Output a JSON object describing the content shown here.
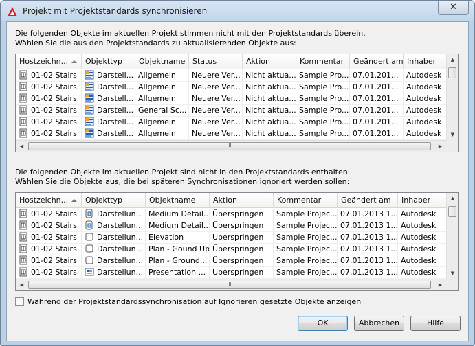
{
  "window": {
    "title": "Projekt mit Projektstandards synchronisieren",
    "close_glyph": "✕"
  },
  "section1": {
    "line1": "Die folgenden Objekte im aktuellen Projekt stimmen nicht mit den Projektstandards überein.",
    "line2": "Wählen Sie die aus den Projektstandards zu aktualisierenden Objekte aus:",
    "columns": [
      "Hostzeichn...",
      "Objekttyp",
      "Objektname",
      "Status",
      "Aktion",
      "Kommentar",
      "Geändert am",
      "Inhaber"
    ],
    "rows": [
      {
        "host": "01-02 Stairs",
        "type": "Darstell...",
        "name": "Allgemein",
        "status": "Neuere Ver...",
        "action": "Nicht aktua...",
        "comment": "Sample Pro...",
        "date": "07.01.201...",
        "owner": "Autodesk"
      },
      {
        "host": "01-02 Stairs",
        "type": "Darstell...",
        "name": "Allgemein",
        "status": "Neuere Ver...",
        "action": "Nicht aktua...",
        "comment": "Sample Pro...",
        "date": "07.01.201...",
        "owner": "Autodesk"
      },
      {
        "host": "01-02 Stairs",
        "type": "Darstell...",
        "name": "Allgemein",
        "status": "Neuere Ver...",
        "action": "Nicht aktua...",
        "comment": "Sample Pro...",
        "date": "07.01.201...",
        "owner": "Autodesk"
      },
      {
        "host": "01-02 Stairs",
        "type": "Darstell...",
        "name": "General Sc...",
        "status": "Neuere Ver...",
        "action": "Nicht aktua...",
        "comment": "Sample Pro...",
        "date": "07.01.201...",
        "owner": "Autodesk"
      },
      {
        "host": "01-02 Stairs",
        "type": "Darstell...",
        "name": "Allgemein",
        "status": "Neuere Ver...",
        "action": "Nicht aktua...",
        "comment": "Sample Pro...",
        "date": "07.01.201...",
        "owner": "Autodesk"
      },
      {
        "host": "01-02 Stairs",
        "type": "Darstell...",
        "name": "Allgemein",
        "status": "Neuere Ver...",
        "action": "Nicht aktua...",
        "comment": "Sample Pro...",
        "date": "07.01.201...",
        "owner": "Autodesk"
      }
    ]
  },
  "section2": {
    "line1": "Die folgenden Objekte im aktuellen Projekt sind nicht in den Projektstandards enthalten.",
    "line2": "Wählen Sie die Objekte aus, die bei späteren Synchronisationen ignoriert werden sollen:",
    "columns": [
      "Hostzeichn...",
      "Objekttyp",
      "Objektname",
      "Aktion",
      "Kommentar",
      "Geändert am",
      "Inhaber"
    ],
    "rows": [
      {
        "host": "01-02 Stairs",
        "type": "Darstellun...",
        "name": "Medium Detail...",
        "action": "Überspringen",
        "comment": "Sample Projec...",
        "date": "07.01.2013 1...",
        "owner": "Autodesk"
      },
      {
        "host": "01-02 Stairs",
        "type": "Darstellun...",
        "name": "Medium Detail...",
        "action": "Überspringen",
        "comment": "Sample Projec...",
        "date": "07.01.2013 1...",
        "owner": "Autodesk"
      },
      {
        "host": "01-02 Stairs",
        "type": "Darstellun...",
        "name": "Elevation",
        "action": "Überspringen",
        "comment": "Sample Projec...",
        "date": "07.01.2013 1...",
        "owner": "Autodesk"
      },
      {
        "host": "01-02 Stairs",
        "type": "Darstellun...",
        "name": "Plan - Gound Up",
        "action": "Überspringen",
        "comment": "Sample Projec...",
        "date": "07.01.2013 1...",
        "owner": "Autodesk"
      },
      {
        "host": "01-02 Stairs",
        "type": "Darstellun...",
        "name": "Plan - Ground...",
        "action": "Überspringen",
        "comment": "Sample Projec...",
        "date": "07.01.2013 1...",
        "owner": "Autodesk"
      },
      {
        "host": "01-02 Stairs",
        "type": "Darstellun...",
        "name": "Presentation ...",
        "action": "Überspringen",
        "comment": "Sample Projec...",
        "date": "07.01.2013 1...",
        "owner": "Autodesk"
      }
    ]
  },
  "checkbox": {
    "label": "Während der Projektstandardssynchronisation auf Ignorieren gesetzte Objekte anzeigen",
    "checked": false
  },
  "buttons": {
    "ok": "OK",
    "cancel": "Abbrechen",
    "help": "Hilfe"
  },
  "scroll_thumb_glyph": "III",
  "colors": {
    "accent": "#3c7fb1",
    "autodesk_red": "#d6232b"
  }
}
